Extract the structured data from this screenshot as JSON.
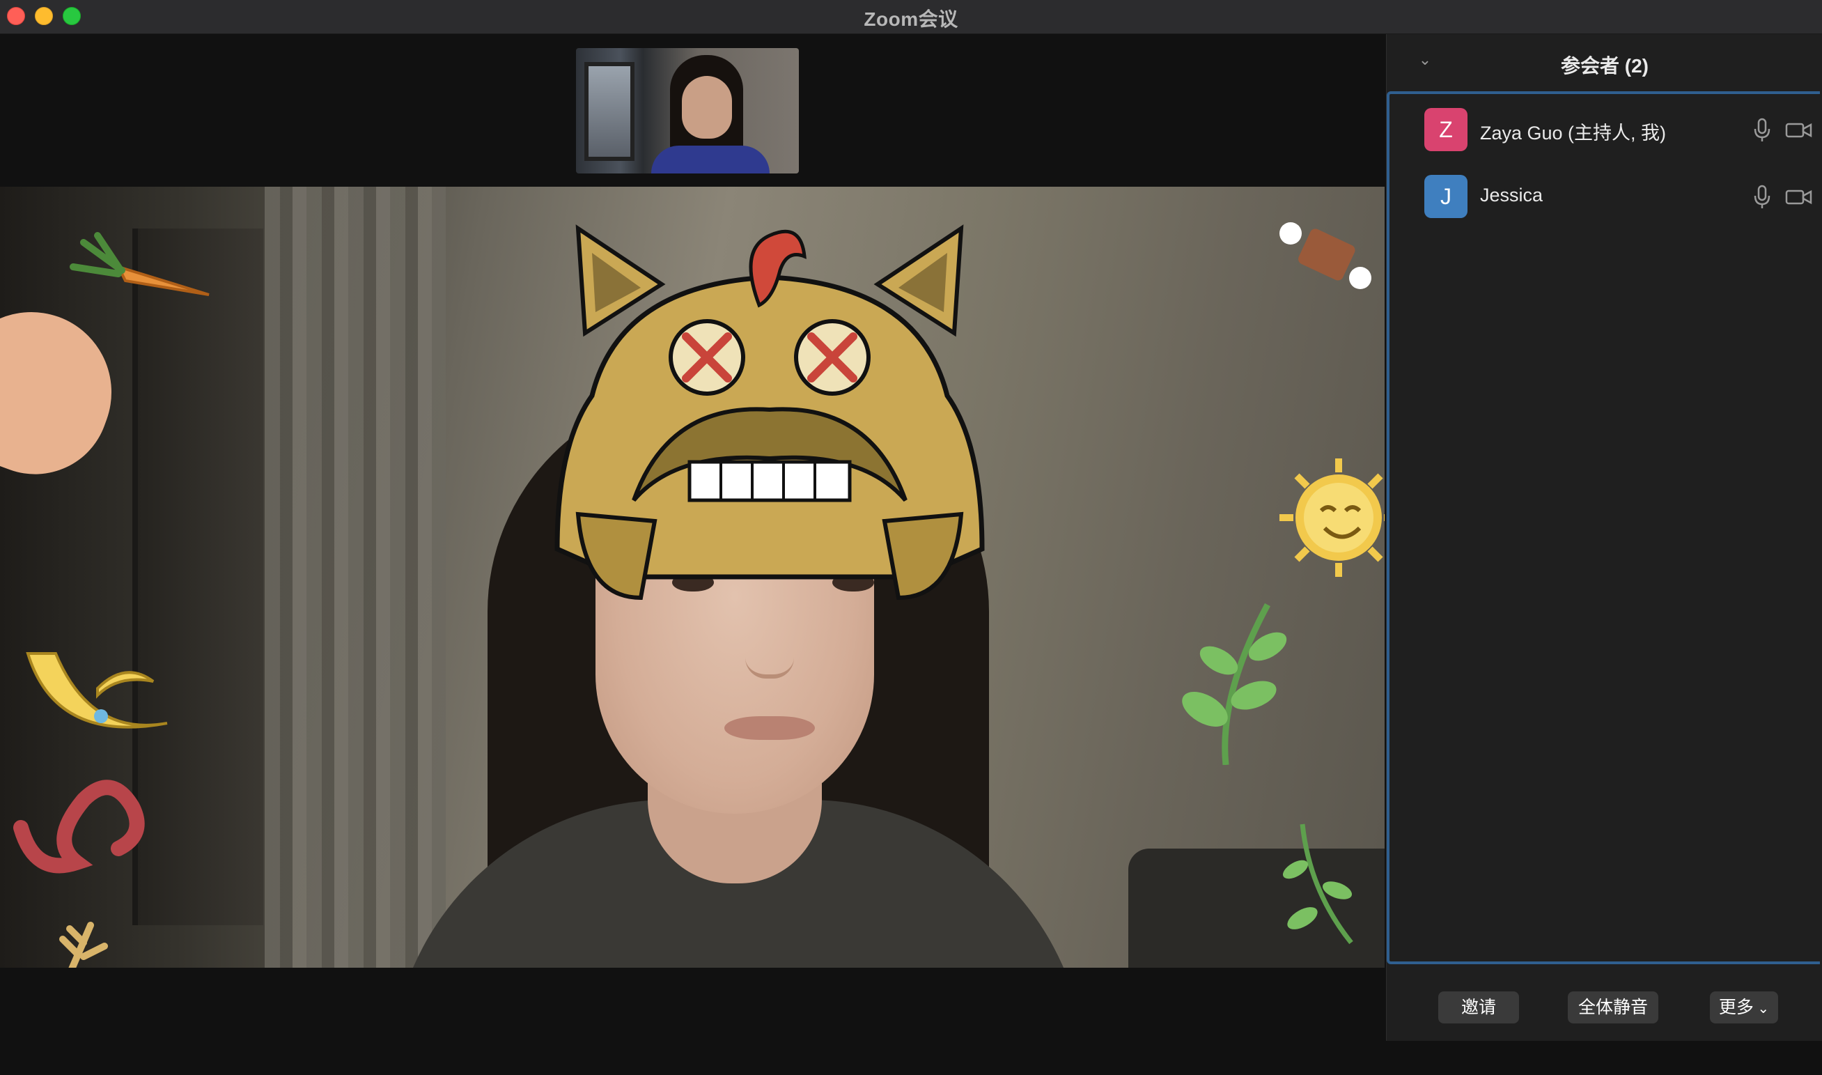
{
  "window": {
    "title": "Zoom会议"
  },
  "panel": {
    "title": "参会者 (2)",
    "participants": [
      {
        "initial": "Z",
        "name": "Zaya Guo (主持人, 我)",
        "avatar_color": "#d9436f"
      },
      {
        "initial": "J",
        "name": "Jessica",
        "avatar_color": "#3f7fbf"
      }
    ],
    "buttons": {
      "invite": "邀请",
      "mute_all": "全体静音",
      "more": "更多"
    }
  },
  "colors": {
    "accent_border": "#2f5f8f",
    "panel_bg": "#1f1f1f"
  }
}
